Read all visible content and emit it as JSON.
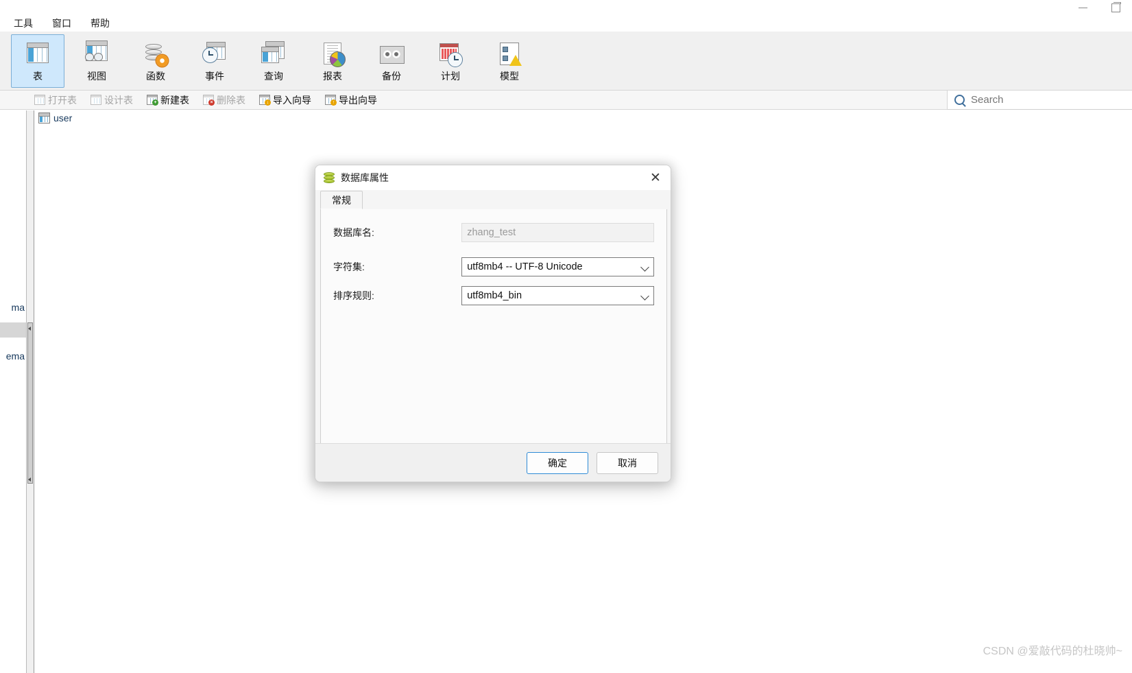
{
  "window": {
    "controls": [
      {
        "name": "minimize",
        "glyph": "minimize-icon"
      },
      {
        "name": "restore",
        "glyph": "restore-icon"
      }
    ]
  },
  "menubar": {
    "items": [
      {
        "label": "工具"
      },
      {
        "label": "窗口"
      },
      {
        "label": "帮助"
      }
    ]
  },
  "ribbon": {
    "items": [
      {
        "label": "表",
        "icon": "table-icon",
        "active": true
      },
      {
        "label": "视图",
        "icon": "view-icon",
        "active": false
      },
      {
        "label": "函数",
        "icon": "function-icon",
        "active": false
      },
      {
        "label": "事件",
        "icon": "event-icon",
        "active": false
      },
      {
        "label": "查询",
        "icon": "query-icon",
        "active": false
      },
      {
        "label": "报表",
        "icon": "report-icon",
        "active": false
      },
      {
        "label": "备份",
        "icon": "backup-icon",
        "active": false
      },
      {
        "label": "计划",
        "icon": "schedule-icon",
        "active": false
      },
      {
        "label": "模型",
        "icon": "model-icon",
        "active": false
      }
    ]
  },
  "subtoolbar": {
    "items": [
      {
        "label": "打开表",
        "icon": "open-table-icon",
        "enabled": false,
        "badge": ""
      },
      {
        "label": "设计表",
        "icon": "design-table-icon",
        "enabled": false,
        "badge": ""
      },
      {
        "label": "新建表",
        "icon": "new-table-icon",
        "enabled": true,
        "badge": "green"
      },
      {
        "label": "删除表",
        "icon": "delete-table-icon",
        "enabled": false,
        "badge": "red"
      },
      {
        "label": "导入向导",
        "icon": "import-wizard-icon",
        "enabled": true,
        "badge": "yellow"
      },
      {
        "label": "导出向导",
        "icon": "export-wizard-icon",
        "enabled": true,
        "badge": "yellow"
      }
    ]
  },
  "search": {
    "placeholder": "Search",
    "value": "",
    "icon": "search-icon"
  },
  "left_panel": {
    "fragments": [
      {
        "text": "ma"
      },
      {
        "text": "ema"
      }
    ]
  },
  "content": {
    "items": [
      {
        "label": "user",
        "icon": "table-icon"
      }
    ]
  },
  "dialog": {
    "title": "数据库属性",
    "icon": "database-icon",
    "close_label": "✕",
    "tabs": [
      {
        "label": "常规",
        "active": true
      }
    ],
    "fields": [
      {
        "label": "数据库名:",
        "type": "text-readonly",
        "value": "zhang_test",
        "name": "database-name-input"
      },
      {
        "label": "字符集:",
        "type": "combo",
        "value": "utf8mb4 -- UTF-8 Unicode",
        "name": "charset-select"
      },
      {
        "label": "排序规则:",
        "type": "combo",
        "value": "utf8mb4_bin",
        "name": "collation-select"
      }
    ],
    "buttons": {
      "ok": "确定",
      "cancel": "取消"
    }
  },
  "watermark": {
    "text": "CSDN @爱敲代码的杜晓帅~"
  },
  "colors": {
    "accent": "#2d8ad6",
    "ribbon_active_bg": "#cfe8fc",
    "tree_text": "#16385c",
    "watermark": "#c6c6c6"
  }
}
